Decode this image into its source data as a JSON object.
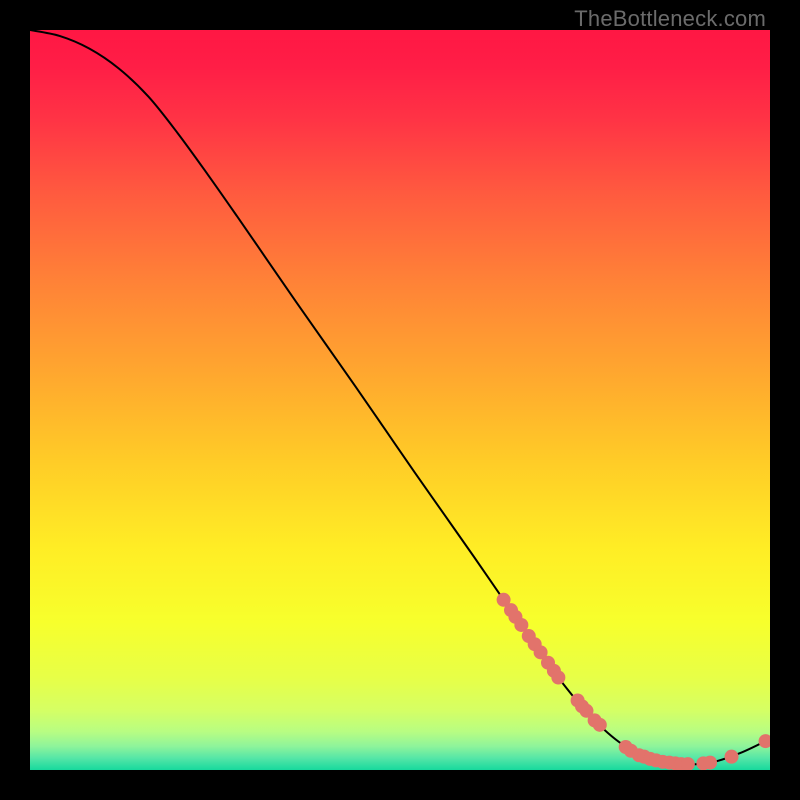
{
  "watermark": "TheBottleneck.com",
  "chart_data": {
    "type": "line",
    "title": "",
    "xlabel": "",
    "ylabel": "",
    "xlim": [
      0,
      100
    ],
    "ylim": [
      0,
      100
    ],
    "curve": [
      {
        "x": 0,
        "y": 100.0
      },
      {
        "x": 4,
        "y": 99.2
      },
      {
        "x": 8,
        "y": 97.5
      },
      {
        "x": 12,
        "y": 94.8
      },
      {
        "x": 16,
        "y": 91.0
      },
      {
        "x": 20,
        "y": 86.0
      },
      {
        "x": 24,
        "y": 80.5
      },
      {
        "x": 28,
        "y": 74.8
      },
      {
        "x": 32,
        "y": 69.0
      },
      {
        "x": 36,
        "y": 63.2
      },
      {
        "x": 40,
        "y": 57.5
      },
      {
        "x": 44,
        "y": 51.8
      },
      {
        "x": 48,
        "y": 46.0
      },
      {
        "x": 52,
        "y": 40.2
      },
      {
        "x": 56,
        "y": 34.5
      },
      {
        "x": 60,
        "y": 28.8
      },
      {
        "x": 64,
        "y": 23.0
      },
      {
        "x": 68,
        "y": 17.3
      },
      {
        "x": 72,
        "y": 11.7
      },
      {
        "x": 76,
        "y": 7.0
      },
      {
        "x": 80,
        "y": 3.5
      },
      {
        "x": 84,
        "y": 1.5
      },
      {
        "x": 88,
        "y": 0.8
      },
      {
        "x": 92,
        "y": 1.0
      },
      {
        "x": 96,
        "y": 2.3
      },
      {
        "x": 100,
        "y": 4.2
      }
    ],
    "markers": [
      {
        "x": 64.0,
        "y": 23.0
      },
      {
        "x": 65.0,
        "y": 21.6
      },
      {
        "x": 65.6,
        "y": 20.7
      },
      {
        "x": 66.4,
        "y": 19.6
      },
      {
        "x": 67.4,
        "y": 18.1
      },
      {
        "x": 68.2,
        "y": 17.0
      },
      {
        "x": 69.0,
        "y": 15.9
      },
      {
        "x": 70.0,
        "y": 14.5
      },
      {
        "x": 70.8,
        "y": 13.4
      },
      {
        "x": 71.4,
        "y": 12.5
      },
      {
        "x": 74.0,
        "y": 9.4
      },
      {
        "x": 74.6,
        "y": 8.6
      },
      {
        "x": 75.2,
        "y": 8.0
      },
      {
        "x": 76.3,
        "y": 6.7
      },
      {
        "x": 77.0,
        "y": 6.1
      },
      {
        "x": 80.5,
        "y": 3.1
      },
      {
        "x": 81.2,
        "y": 2.6
      },
      {
        "x": 82.3,
        "y": 2.0
      },
      {
        "x": 83.0,
        "y": 1.8
      },
      {
        "x": 83.8,
        "y": 1.5
      },
      {
        "x": 84.6,
        "y": 1.3
      },
      {
        "x": 85.5,
        "y": 1.1
      },
      {
        "x": 86.4,
        "y": 1.0
      },
      {
        "x": 87.2,
        "y": 0.9
      },
      {
        "x": 88.0,
        "y": 0.8
      },
      {
        "x": 88.9,
        "y": 0.8
      },
      {
        "x": 91.0,
        "y": 0.9
      },
      {
        "x": 91.9,
        "y": 1.0
      },
      {
        "x": 94.8,
        "y": 1.8
      },
      {
        "x": 99.4,
        "y": 3.9
      }
    ],
    "marker_color": "#e2736b",
    "line_color": "#000000",
    "gradient_stops": [
      {
        "pos": 0.0,
        "color": "#ff1744"
      },
      {
        "pos": 0.05,
        "color": "#ff1e46"
      },
      {
        "pos": 0.12,
        "color": "#ff3345"
      },
      {
        "pos": 0.22,
        "color": "#ff5a3f"
      },
      {
        "pos": 0.34,
        "color": "#ff8237"
      },
      {
        "pos": 0.46,
        "color": "#ffa62f"
      },
      {
        "pos": 0.58,
        "color": "#ffcb27"
      },
      {
        "pos": 0.7,
        "color": "#ffed25"
      },
      {
        "pos": 0.8,
        "color": "#f7ff2c"
      },
      {
        "pos": 0.875,
        "color": "#e7ff47"
      },
      {
        "pos": 0.918,
        "color": "#d6ff63"
      },
      {
        "pos": 0.948,
        "color": "#b8fd82"
      },
      {
        "pos": 0.968,
        "color": "#8ef49b"
      },
      {
        "pos": 0.984,
        "color": "#55e6a7"
      },
      {
        "pos": 1.0,
        "color": "#17d99d"
      }
    ]
  }
}
